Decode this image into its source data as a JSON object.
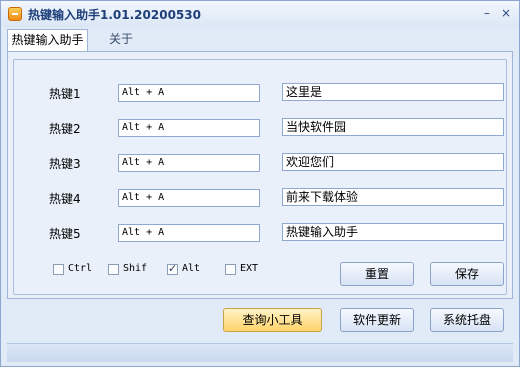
{
  "window": {
    "title": "热键输入助手1.01.20200530"
  },
  "titlebar": {
    "minimize": "–",
    "close": "×"
  },
  "tabs": [
    {
      "label": "热键输入助手"
    },
    {
      "label": "关于"
    }
  ],
  "hotkeys": [
    {
      "label": "热键1",
      "key": "Alt + A",
      "text": "这里是"
    },
    {
      "label": "热键2",
      "key": "Alt + A",
      "text": "当快软件园"
    },
    {
      "label": "热键3",
      "key": "Alt + A",
      "text": "欢迎您们"
    },
    {
      "label": "热键4",
      "key": "Alt + A",
      "text": "前来下载体验"
    },
    {
      "label": "热键5",
      "key": "Alt + A",
      "text": "热键输入助手"
    }
  ],
  "modifiers": [
    {
      "label": "Ctrl",
      "checked": false
    },
    {
      "label": "Shif",
      "checked": false
    },
    {
      "label": "Alt",
      "checked": true
    },
    {
      "label": "EXT",
      "checked": false
    }
  ],
  "buttons": {
    "reset": "重置",
    "save": "保存",
    "query_tools": "查询小工具",
    "update": "软件更新",
    "tray": "系统托盘"
  },
  "check_mark": "✓"
}
